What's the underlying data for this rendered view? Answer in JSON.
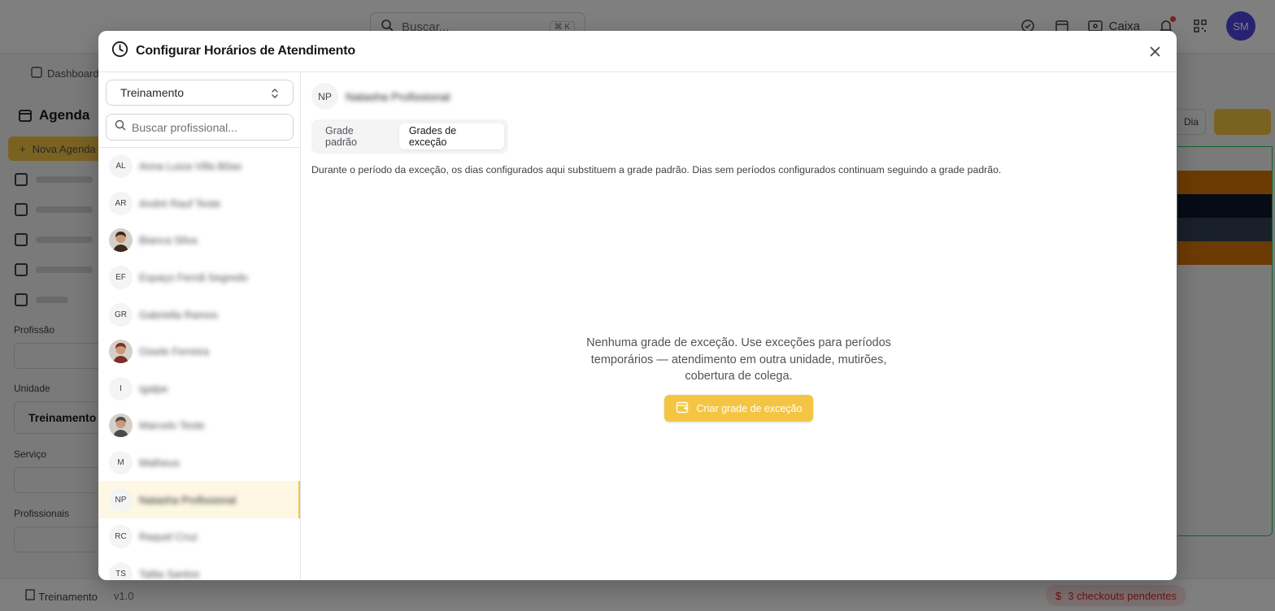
{
  "background": {
    "search_placeholder": "Buscar...",
    "search_shortcut": "⌘ K",
    "caixa_label": "Caixa",
    "user_initials": "SM",
    "breadcrumb": "Dashboard",
    "page_title": "Agenda",
    "new_button": "Nova Agenda",
    "filters": {
      "profissao": "Profissão",
      "unidade": "Unidade",
      "unidade_value": "Treinamento",
      "servico": "Serviço",
      "profissionais": "Profissionais"
    },
    "view_day": "Dia",
    "footer": {
      "unit": "Treinamento",
      "version": "v1.0",
      "pending": "3 checkouts pendentes"
    }
  },
  "modal": {
    "title": "Configurar Horários de Atendimento",
    "unit_select": "Treinamento",
    "search_placeholder": "Buscar profissional...",
    "professionals": [
      {
        "initials": "AL",
        "name": "Anna Luiza Villa Bôas",
        "photo": false
      },
      {
        "initials": "AR",
        "name": "André Rauf Teste",
        "photo": false
      },
      {
        "initials": "",
        "name": "Bianca Silva",
        "photo": true,
        "tone": "#3b2a1e"
      },
      {
        "initials": "EF",
        "name": "Espaço Fernã Segredo",
        "photo": false
      },
      {
        "initials": "GR",
        "name": "Gabriella Ramos",
        "photo": false
      },
      {
        "initials": "",
        "name": "Gisele Ferreira",
        "photo": true,
        "tone": "#7a2f2a"
      },
      {
        "initials": "I",
        "name": "Igalpe",
        "photo": false
      },
      {
        "initials": "",
        "name": "Marcelo Teste",
        "photo": true,
        "tone": "#4a4a4a"
      },
      {
        "initials": "M",
        "name": "Matheus",
        "photo": false
      },
      {
        "initials": "NP",
        "name": "Natasha Profissional",
        "photo": false,
        "selected": true
      },
      {
        "initials": "RC",
        "name": "Raquel Cruz",
        "photo": false
      },
      {
        "initials": "TS",
        "name": "Talita Santos",
        "photo": false
      }
    ],
    "selected_professional": {
      "initials": "NP",
      "name": "Natasha Profissional"
    },
    "tabs": [
      {
        "label": "Grade padrão",
        "active": false
      },
      {
        "label": "Grades de exceção",
        "active": true
      }
    ],
    "info_text": "Durante o período da exceção, os dias configurados aqui substituem a grade padrão. Dias sem períodos configurados continuam seguindo a grade padrão.",
    "empty_line1": "Nenhuma grade de exceção. Use exceções para períodos",
    "empty_line2": "temporários — atendimento em outra unidade, mutirões,",
    "empty_line3": "cobertura de colega.",
    "create_button": "Criar grade de exceção",
    "accent_color": "#f4c542"
  }
}
